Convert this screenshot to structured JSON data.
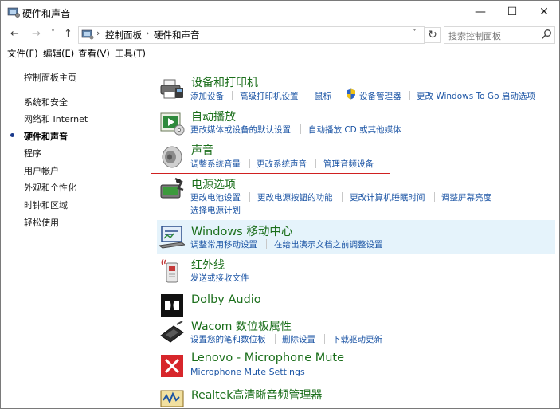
{
  "window": {
    "title": "硬件和声音",
    "controls": [
      "—",
      "☐",
      "✕"
    ]
  },
  "nav": {
    "back": "←",
    "forward": "→",
    "recent": "˅",
    "up": "↑",
    "breadcrumb": [
      "控制面板",
      "硬件和声音"
    ],
    "separator": "›",
    "dropdown": "˅",
    "refresh": "↻",
    "search_placeholder": "搜索控制面板"
  },
  "menu": [
    "文件(F)",
    "编辑(E)",
    "查看(V)",
    "工具(T)"
  ],
  "sidebar": {
    "items": [
      {
        "label": "控制面板主页",
        "current": false
      },
      {
        "label": "系统和安全",
        "current": false
      },
      {
        "label": "网络和 Internet",
        "current": false
      },
      {
        "label": "硬件和声音",
        "current": true
      },
      {
        "label": "程序",
        "current": false
      },
      {
        "label": "用户帐户",
        "current": false
      },
      {
        "label": "外观和个性化",
        "current": false
      },
      {
        "label": "时钟和区域",
        "current": false
      },
      {
        "label": "轻松使用",
        "current": false
      }
    ]
  },
  "categories": [
    {
      "title": "设备和打印机",
      "icon": "printer-icon",
      "links": [
        "添加设备",
        "高级打印机设置",
        "鼠标",
        "设备管理器",
        "更改 Windows To Go 启动选项"
      ]
    },
    {
      "title": "自动播放",
      "icon": "autoplay-icon",
      "links": [
        "更改媒体或设备的默认设置",
        "自动播放 CD 或其他媒体"
      ]
    },
    {
      "title": "声音",
      "icon": "speaker-icon",
      "links": [
        "调整系统音量",
        "更改系统声音",
        "管理音频设备"
      ]
    },
    {
      "title": "电源选项",
      "icon": "power-icon",
      "links": [
        "更改电池设置",
        "更改电源按钮的功能",
        "更改计算机睡眠时间",
        "调整屏幕亮度",
        "选择电源计划"
      ]
    },
    {
      "title": "Windows 移动中心",
      "icon": "mobility-center-icon",
      "links": [
        "调整常用移动设置",
        "在给出演示文档之前调整设置"
      ]
    },
    {
      "title": "红外线",
      "icon": "infrared-icon",
      "links": [
        "发送或接收文件"
      ]
    },
    {
      "title": "Dolby Audio",
      "icon": "dolby-icon",
      "links": []
    },
    {
      "title": "Wacom 数位板属性",
      "icon": "tablet-icon",
      "links": [
        "设置您的笔和数位板",
        "删除设置",
        "下载驱动更新"
      ]
    },
    {
      "title": "Lenovo - Microphone Mute",
      "icon": "microphone-mute-icon",
      "links": [
        "Microphone Mute Settings"
      ]
    },
    {
      "title": "Realtek高清晰音频管理器",
      "icon": "realtek-audio-icon",
      "links": []
    }
  ],
  "colors": {
    "title_green": "#1a6e1a",
    "link_blue": "#1c55a5",
    "highlight": "#e5f3fb",
    "annotation_red": "#d02020"
  }
}
